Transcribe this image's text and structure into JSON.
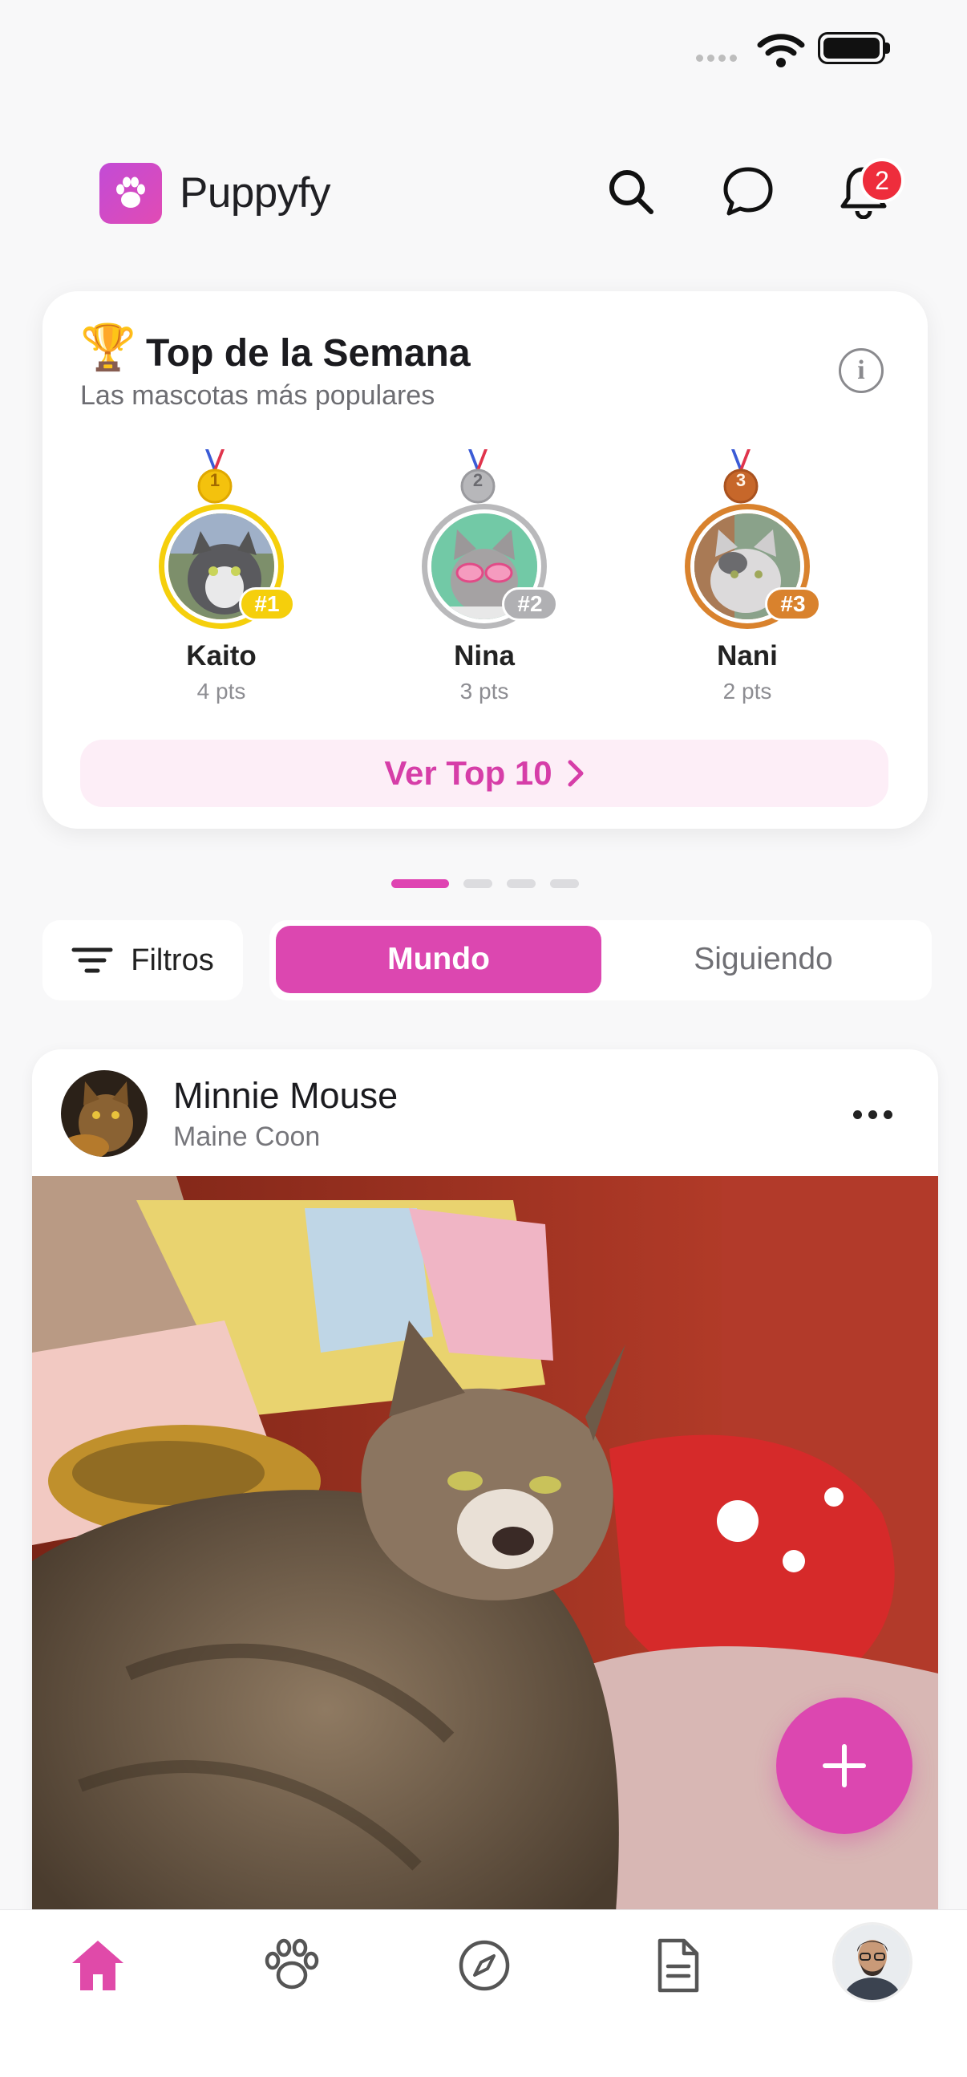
{
  "app": {
    "name": "Puppyfy",
    "brand_color": "#dc47b0",
    "notifications_count": "2"
  },
  "icons": {
    "logo": "paw-logo-icon",
    "search": "search-icon",
    "chat": "chat-bubble-icon",
    "notifications": "bell-icon",
    "info": "info-icon",
    "filter": "filter-icon",
    "more": "more-horizontal-icon",
    "add": "plus-icon"
  },
  "top_week": {
    "title": "Top de la Semana",
    "trophy": "🏆",
    "subtitle": "Las mascotas más populares",
    "info_glyph": "i",
    "entries": [
      {
        "rank": "#1",
        "medal_number": "1",
        "name": "Kaito",
        "points": "4 pts",
        "ring_color": "#f5cf0c"
      },
      {
        "rank": "#2",
        "medal_number": "2",
        "name": "Nina",
        "points": "3 pts",
        "ring_color": "#b9b9bb"
      },
      {
        "rank": "#3",
        "medal_number": "3",
        "name": "Nani",
        "points": "2 pts",
        "ring_color": "#d9822d"
      }
    ],
    "cta_label": "Ver Top 10",
    "carousel_pages": 4,
    "carousel_active_index": 0
  },
  "feed_filters": {
    "filters_label": "Filtros",
    "tabs": [
      {
        "label": "Mundo",
        "selected": true
      },
      {
        "label": "Siguiendo",
        "selected": false
      }
    ]
  },
  "post": {
    "author_name": "Minnie Mouse",
    "breed": "Maine Coon"
  },
  "bottom_nav": {
    "items": [
      {
        "icon": "home-icon",
        "active": true
      },
      {
        "icon": "paw-icon",
        "active": false
      },
      {
        "icon": "compass-icon",
        "active": false
      },
      {
        "icon": "document-icon",
        "active": false
      },
      {
        "icon": "profile-avatar",
        "active": false
      }
    ]
  }
}
